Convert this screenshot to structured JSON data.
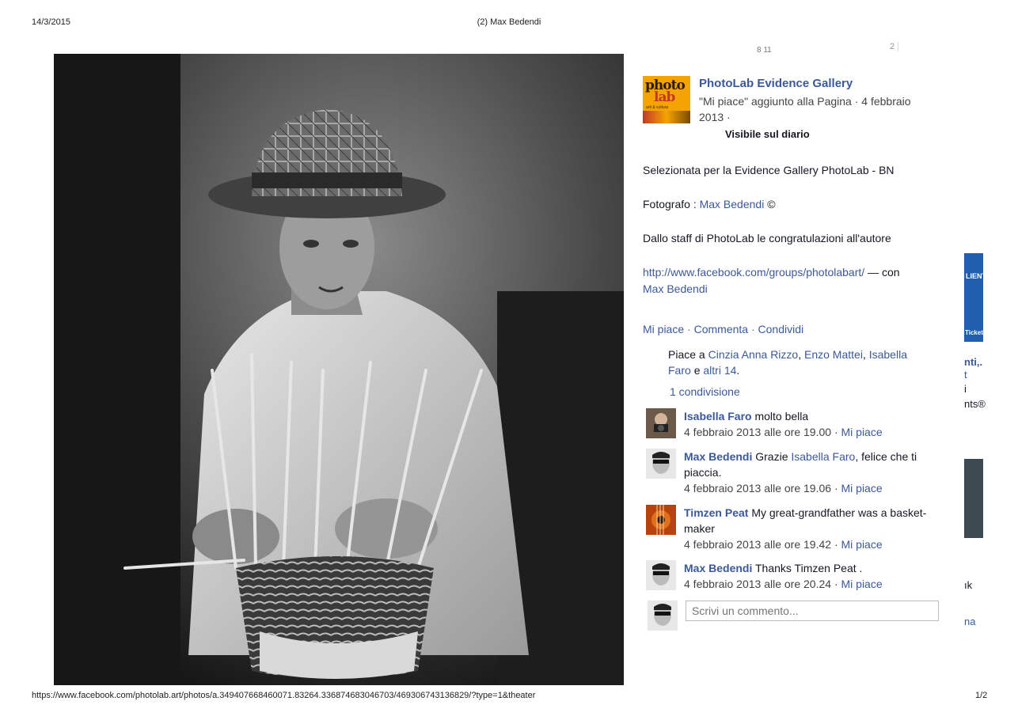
{
  "print_header": {
    "date": "14/3/2015",
    "title": "(2) Max Bedendi"
  },
  "print_footer": {
    "url": "https://www.facebook.com/photolab.art/photos/a.349407668460071.83264.336874683046703/469306743136829/?type=1&theater",
    "page": "1/2"
  },
  "photo": {
    "subject": "black-and-white portrait of an elderly man in a hat weaving a wicker basket",
    "icon": "photo-image"
  },
  "top_counts": {
    "left": "8 11",
    "right": "2"
  },
  "post": {
    "page_logo": {
      "line1": "photo",
      "line2": "lab",
      "line3": "arti & cultura",
      "icon": "photolab-logo"
    },
    "page_name": "PhotoLab Evidence Gallery",
    "meta": "\"Mi piace\" aggiunto alla Pagina · 4 febbraio 2013 ·",
    "visibility": "Visibile sul diario",
    "text_line1": "Selezionata per la Evidence Gallery PhotoLab - BN",
    "photographer_prefix": "Fotografo :",
    "photographer_name": "Max Bedendi",
    "photographer_suffix": "©",
    "text_line3": "Dallo staff di PhotoLab le congratulazioni all'autore",
    "group_link": "http://www.facebook.com/groups/photolabart/",
    "with_text": "— con",
    "with_name": "Max Bedendi"
  },
  "actions": {
    "like": "Mi piace",
    "comment": "Commenta",
    "share": "Condividi",
    "sep": "·"
  },
  "likes": {
    "prefix": "Piace a",
    "names": [
      "Cinzia Anna Rizzo",
      "Enzo Mattei",
      "Isabella Faro"
    ],
    "and": "e",
    "others": "altri 14",
    "end": "."
  },
  "shares": "1 condivisione",
  "comments": [
    {
      "author": "Isabella Faro",
      "text": "molto bella",
      "time": "4 febbraio 2013 alle ore 19.00",
      "like": "Mi piace",
      "avatar": "woman-camera-avatar"
    },
    {
      "author": "Max Bedendi",
      "text_pre": "Grazie",
      "mention": "Isabella Faro",
      "text_post": ", felice che ti piaccia.",
      "time": "4 febbraio 2013 alle ore 19.06",
      "like": "Mi piace",
      "avatar": "man-glasses-avatar"
    },
    {
      "author": "Timzen Peat",
      "text": "My great-grandfather was a basket-maker",
      "time": "4 febbraio 2013 alle ore 19.42",
      "like": "Mi piace",
      "avatar": "guitar-avatar"
    },
    {
      "author": "Max Bedendi",
      "text": "Thanks Timzen Peat .",
      "time": "4 febbraio 2013 alle ore 20.24",
      "like": "Mi piace",
      "avatar": "man-glasses-avatar"
    }
  ],
  "compose": {
    "placeholder": "Scrivi un commento..."
  },
  "sidebar_fragments": {
    "f1": "LIENTI",
    "f2": "Ticket",
    "f3": "nti,.",
    "f4": "t",
    "f5": "i",
    "f6": "nts®",
    "f7": "ık",
    "f8": "na"
  }
}
